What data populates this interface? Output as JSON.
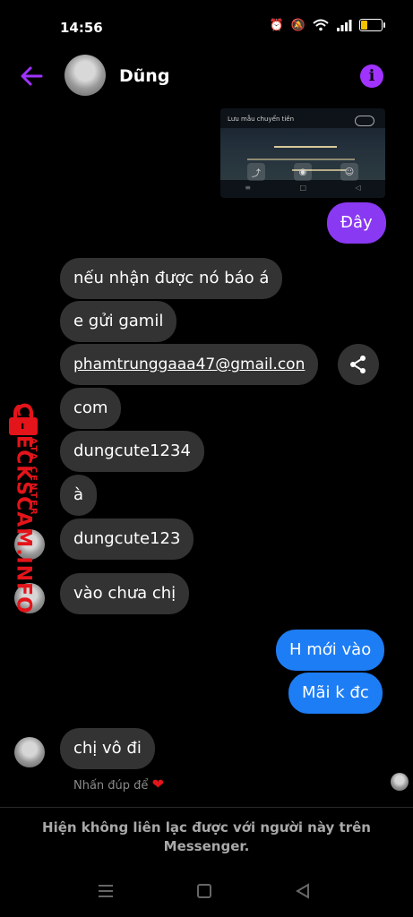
{
  "status_bar": {
    "time": "14:56"
  },
  "header": {
    "contact_name": "Dũng"
  },
  "shared_image": {
    "label": "Lưu mẫu chuyển tiền"
  },
  "messages": [
    {
      "side": "out",
      "text": "Đây"
    },
    {
      "side": "in",
      "text": "nếu nhận được nó báo á"
    },
    {
      "side": "in",
      "text": "e gửi gamil"
    },
    {
      "side": "in",
      "text": "phamtrunggaaa47@gmail.con"
    },
    {
      "side": "in",
      "text": "com"
    },
    {
      "side": "in",
      "text": "dungcute1234"
    },
    {
      "side": "in",
      "text": "à"
    },
    {
      "side": "in",
      "text": "dungcute123"
    },
    {
      "side": "in",
      "text": "vào chưa chị"
    },
    {
      "side": "out",
      "text": "H mới vào"
    },
    {
      "side": "out",
      "text": "Mãi k đc"
    },
    {
      "side": "in",
      "text": "chị vô đi"
    }
  ],
  "reaction_hint": "Nhấn đúp để",
  "footer_notice": "Hiện không liên lạc được với người này trên Messenger.",
  "watermark": {
    "brand": "CHECKSCAM.INFO",
    "sub": "DATA CENTER"
  },
  "colors": {
    "accent": "#8a39f2",
    "outgoing_blue": "#1d7df5",
    "incoming": "#333333",
    "watermark": "#e3141a"
  },
  "icons": [
    "back-arrow-icon",
    "info-icon",
    "share-icon",
    "heart-icon",
    "alarm-icon",
    "mute-icon",
    "wifi-icon",
    "signal-icon",
    "battery-icon"
  ]
}
